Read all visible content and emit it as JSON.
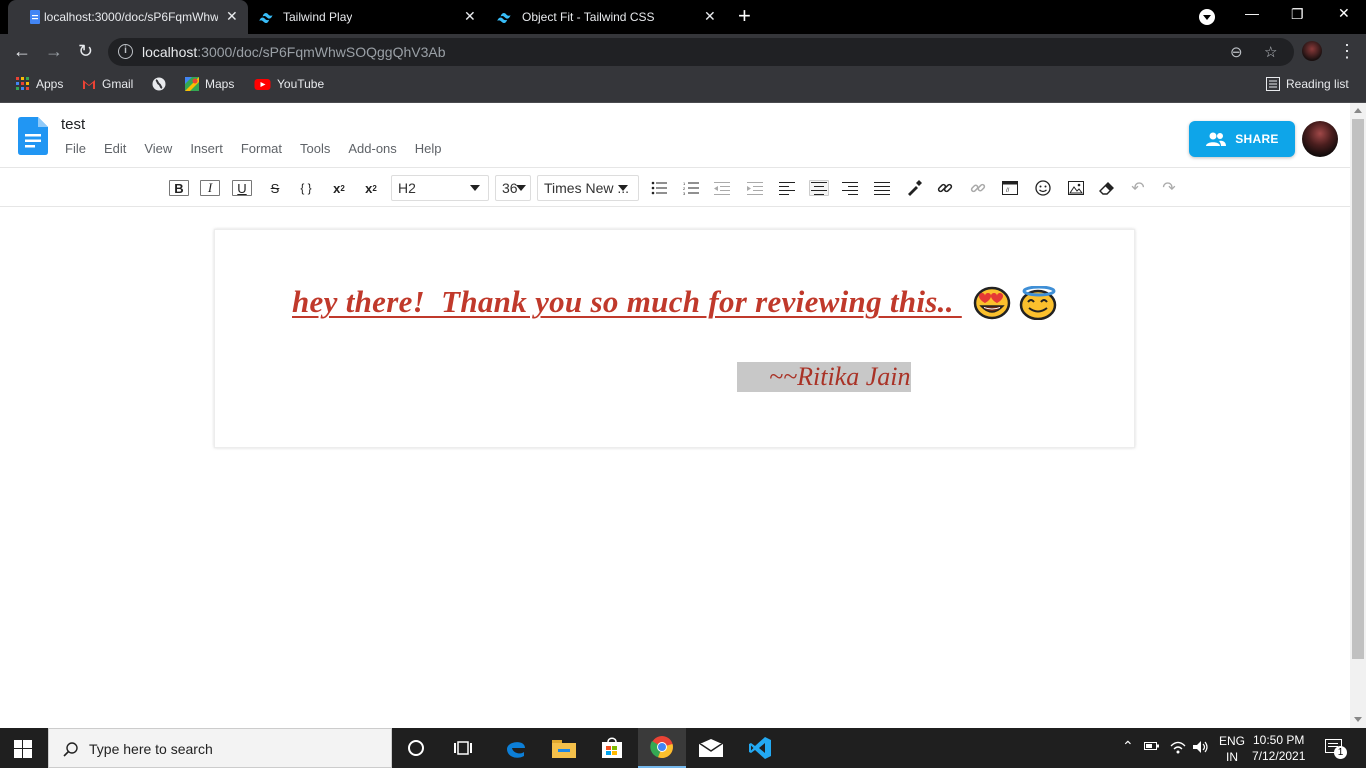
{
  "browser": {
    "tabs": [
      {
        "title": "localhost:3000/doc/sP6FqmWhw",
        "active": true
      },
      {
        "title": "Tailwind Play",
        "active": false
      },
      {
        "title": "Object Fit - Tailwind CSS",
        "active": false
      }
    ],
    "url_host": "localhost",
    "url_rest": ":3000/doc/sP6FqmWhwSOQggQhV3Ab",
    "bookmarks": [
      "Apps",
      "Gmail",
      "Maps",
      "YouTube"
    ],
    "reading_list": "Reading list"
  },
  "app": {
    "doc_title": "test",
    "menu": [
      "File",
      "Edit",
      "View",
      "Insert",
      "Format",
      "Tools",
      "Add-ons",
      "Help"
    ],
    "share_label": "SHARE"
  },
  "toolbar": {
    "bold": "B",
    "italic": "I",
    "underline": "U",
    "strike": "S",
    "code": "{ }",
    "heading_select": "H2",
    "size_select": "36",
    "font_select": "Times New ..."
  },
  "document": {
    "line1": "hey there!  Thank you so much for reviewing this.. ",
    "line2": "~~Ritika Jain",
    "emojis": [
      "heart-eyes-emoji",
      "halo-smile-emoji"
    ]
  },
  "taskbar": {
    "search_placeholder": "Type here to search",
    "lang_top": "ENG",
    "lang_bottom": "IN",
    "time": "10:50 PM",
    "date": "7/12/2021",
    "notification_count": "1"
  },
  "colors": {
    "accent": "#0ea5e9",
    "doc_text": "#c0392b",
    "chrome_dark": "#35363a"
  }
}
